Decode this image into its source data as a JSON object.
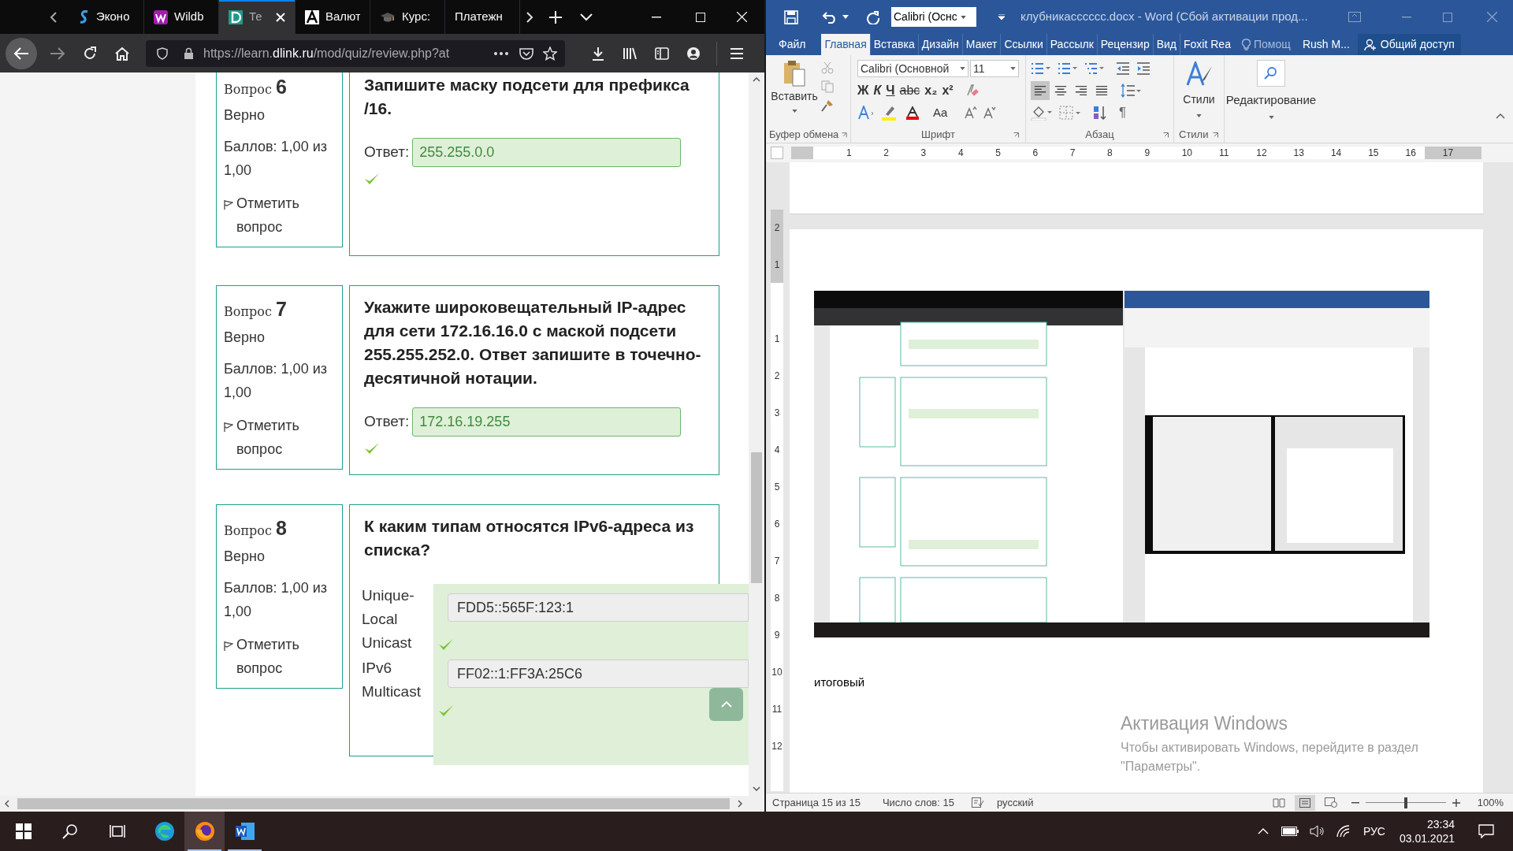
{
  "browser": {
    "tabs": [
      {
        "kind": "s",
        "label": "Эконо",
        "selected": false
      },
      {
        "kind": "w",
        "label": "Wildb",
        "selected": false
      },
      {
        "kind": "d",
        "label": "Те",
        "selected": true
      },
      {
        "kind": "a",
        "label": "Валют",
        "selected": false
      },
      {
        "kind": "cap",
        "label": "Курс:",
        "selected": false
      },
      {
        "kind": "none",
        "label": "Платежн",
        "selected": false
      }
    ],
    "address": "https://learn.**dlink.ru**/mod/quiz/review.php?at",
    "questions": [
      {
        "kind": "short",
        "prefix": "Вопрос",
        "number": "6",
        "status": "Верно",
        "score": "Баллов: 1,00 из 1,00",
        "flag": "Отметить вопрос",
        "text": "Запишите маску подсети для префикса /16.",
        "answer_label": "Ответ:",
        "answer": "255.255.0.0",
        "correct": true
      },
      {
        "kind": "short",
        "prefix": "Вопрос",
        "number": "7",
        "status": "Верно",
        "score": "Баллов: 1,00 из 1,00",
        "flag": "Отметить вопрос",
        "text": "Укажите широковещательный IP-адрес для сети 172.16.16.0 с маской подсети 255.255.252.0. Ответ запишите в точечно-десятичной нотации.",
        "answer_label": "Ответ:",
        "answer": "172.16.19.255",
        "correct": true
      },
      {
        "kind": "match",
        "prefix": "Вопрос",
        "number": "8",
        "status": "Верно",
        "score": "Баллов: 1,00 из 1,00",
        "flag": "Отметить вопрос",
        "text": "К каким типам относятся IPv6-адреса из списка?",
        "pairs": [
          {
            "label": "Unique-Local Unicast",
            "value": "FDD5::565F:123:1",
            "correct": true
          },
          {
            "label": "IPv6 Multicast",
            "value": "FF02::1:FF3A:25C6",
            "correct": true
          }
        ]
      }
    ]
  },
  "word": {
    "qat_font": "Calibri (Оснс",
    "title": "клубникасссссс.docx - Word (Сбой активации прод...",
    "tabs": [
      {
        "label": "Файл",
        "selected": false
      },
      {
        "label": "Главная",
        "selected": true
      },
      {
        "label": "Вставка",
        "selected": false
      },
      {
        "label": "Дизайн",
        "selected": false
      },
      {
        "label": "Макет",
        "selected": false
      },
      {
        "label": "Ссылки",
        "selected": false
      },
      {
        "label": "Рассылк",
        "selected": false
      },
      {
        "label": "Рецензир",
        "selected": false
      },
      {
        "label": "Вид",
        "selected": false
      },
      {
        "label": "Foxit Rea",
        "selected": false
      }
    ],
    "help": "Помощ",
    "user": "Rush M...",
    "share": "Общий доступ",
    "paste": "Вставить",
    "font_name": "Calibri (Основной",
    "font_size": "11",
    "format_buttons": [
      "Ж",
      "К",
      "Ч",
      "abc",
      "x₂",
      "x²"
    ],
    "case_button": "Aa",
    "pilcrow": "¶",
    "align_buttons": [
      {
        "kind": "left",
        "selected": true
      },
      {
        "kind": "center",
        "selected": false
      },
      {
        "kind": "right",
        "selected": false
      },
      {
        "kind": "justify",
        "selected": false
      }
    ],
    "styles": "Стили",
    "editing": "Редактирование",
    "groups": [
      "Буфер обмена",
      "Шрифт",
      "Абзац",
      "Стили"
    ],
    "ruler": [
      "1",
      "2",
      "3",
      "4",
      "5",
      "6",
      "7",
      "8",
      "9",
      "10",
      "11",
      "12",
      "13",
      "14",
      "15",
      "16",
      "17"
    ],
    "vruler": [
      "2",
      "1",
      "1",
      "2",
      "3",
      "4",
      "5",
      "6",
      "7",
      "8",
      "9",
      "10",
      "11",
      "12"
    ],
    "doc_text": "итоговый",
    "status": [
      "Страница 15 из 15",
      "Число слов: 15",
      "русский"
    ],
    "zoom": {
      "level": 0.5,
      "reading": "100%"
    }
  },
  "activation": {
    "title": "Активация Windows",
    "text": "Чтобы активировать Windows, перейдите в раздел \"Параметры\"."
  },
  "taskbar": {
    "apps": [
      {
        "kind": "edge",
        "running": false,
        "selected": false
      },
      {
        "kind": "firefox",
        "running": true,
        "selected": true
      },
      {
        "kind": "word",
        "running": true,
        "selected": false
      }
    ],
    "language": "РУС",
    "time": "23:34",
    "date": "03.01.2021"
  }
}
